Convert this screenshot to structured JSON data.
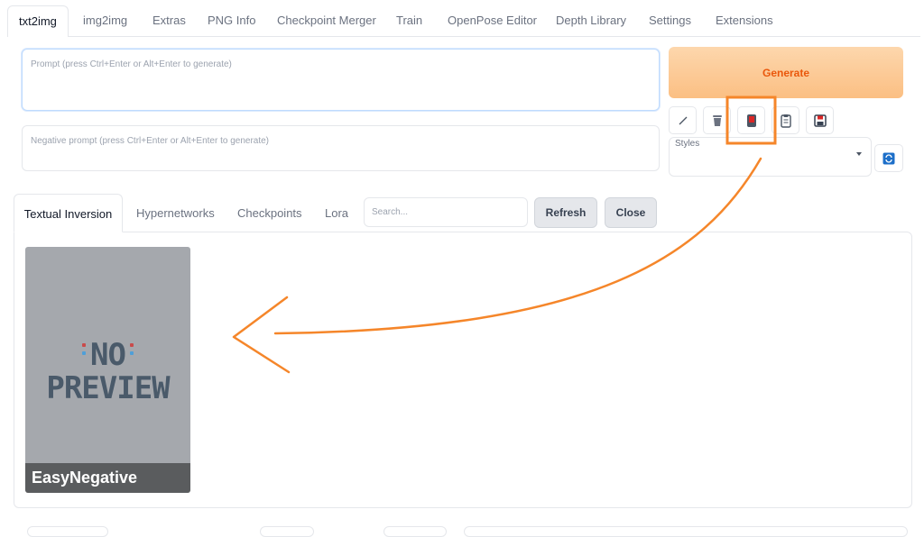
{
  "tabs": [
    "txt2img",
    "img2img",
    "Extras",
    "PNG Info",
    "Checkpoint Merger",
    "Train",
    "OpenPose Editor",
    "Depth Library",
    "Settings",
    "Extensions"
  ],
  "prompt": {
    "placeholder": "Prompt (press Ctrl+Enter or Alt+Enter to generate)",
    "value": ""
  },
  "negative_prompt": {
    "placeholder": "Negative prompt (press Ctrl+Enter or Alt+Enter to generate)",
    "value": ""
  },
  "generate_label": "Generate",
  "toolbar_icons": [
    "paste-icon",
    "trash-icon",
    "extra-networks-icon",
    "clipboard-icon",
    "save-icon"
  ],
  "styles": {
    "label": "Styles",
    "selected": ""
  },
  "extra_networks": {
    "tabs": [
      "Textual Inversion",
      "Hypernetworks",
      "Checkpoints",
      "Lora"
    ],
    "active_tab": "Textual Inversion",
    "search_placeholder": "Search...",
    "refresh_label": "Refresh",
    "close_label": "Close",
    "cards": [
      {
        "preview_line1": "NO",
        "preview_line2": "PREVIEW",
        "name": "EasyNegative"
      }
    ]
  },
  "annotation": {
    "color": "#f5862a",
    "highlighted": "extra-networks-icon"
  },
  "colors": {
    "generate_text": "#ea580c",
    "accent": "#2563eb"
  }
}
